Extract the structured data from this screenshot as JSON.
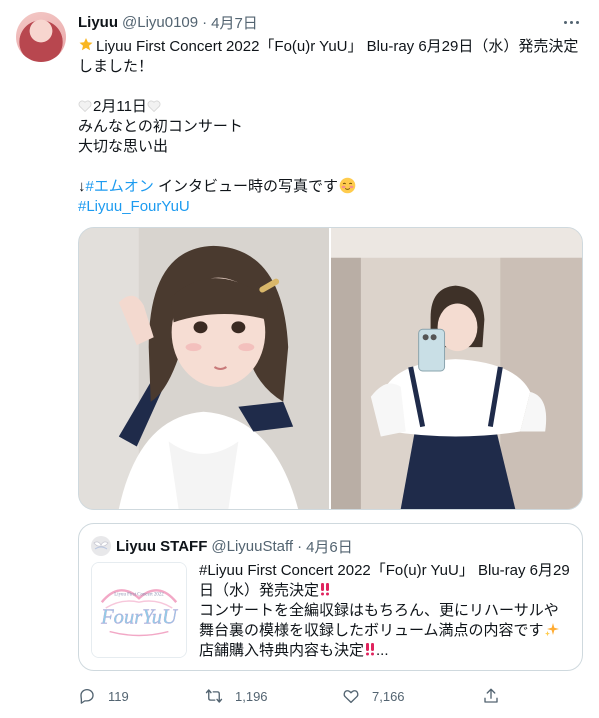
{
  "tweet": {
    "author": {
      "display_name": "Liyuu",
      "handle": "@Liyu0109",
      "separator": "·",
      "date": "4月7日"
    },
    "lines": {
      "line1_text": "Liyuu First Concert 2022「Fo(u)r YuU」 Blu-ray 6月29日（水）発売決定",
      "line2_text": "しました！",
      "line3_text": "2月11日",
      "line4_text": "みんなとの初コンサート",
      "line5_text": "大切な思い出",
      "line6_prefix": "↓",
      "line6_hashtag": "#エムオン",
      "line6_text": " インタビュー時の写真です",
      "line7_hashtag": "#Liyuu_FourYuU"
    },
    "icons": {
      "star": "glowing-star-icon",
      "heart": "white-heart-icon",
      "blush": "smiling-face-icon"
    }
  },
  "quote": {
    "display_name": "Liyuu STAFF",
    "handle": "@LiyuuStaff",
    "separator": "·",
    "date": "4月6日",
    "lines": [
      "#Liyuu First Concert 2022「Fo(u)r YuU」 Blu-ray 6月29",
      "日（水）発売決定",
      "コンサートを全編収録はもちろん、更にリハーサルや",
      "舞台裏の模様を収録したボリューム満点の内容です",
      "店舗購入特典内容も決定"
    ],
    "ellipsis": "...",
    "thumbnail": {
      "logo_small_text": "Liyuu First Concert 2022",
      "logo_text": "FourYuU"
    }
  },
  "actions": {
    "replies": "119",
    "retweets": "1,196",
    "likes": "7,166"
  },
  "colors": {
    "link": "#1d9bf0",
    "secondary_text": "#536471",
    "border": "#cfd9de"
  }
}
